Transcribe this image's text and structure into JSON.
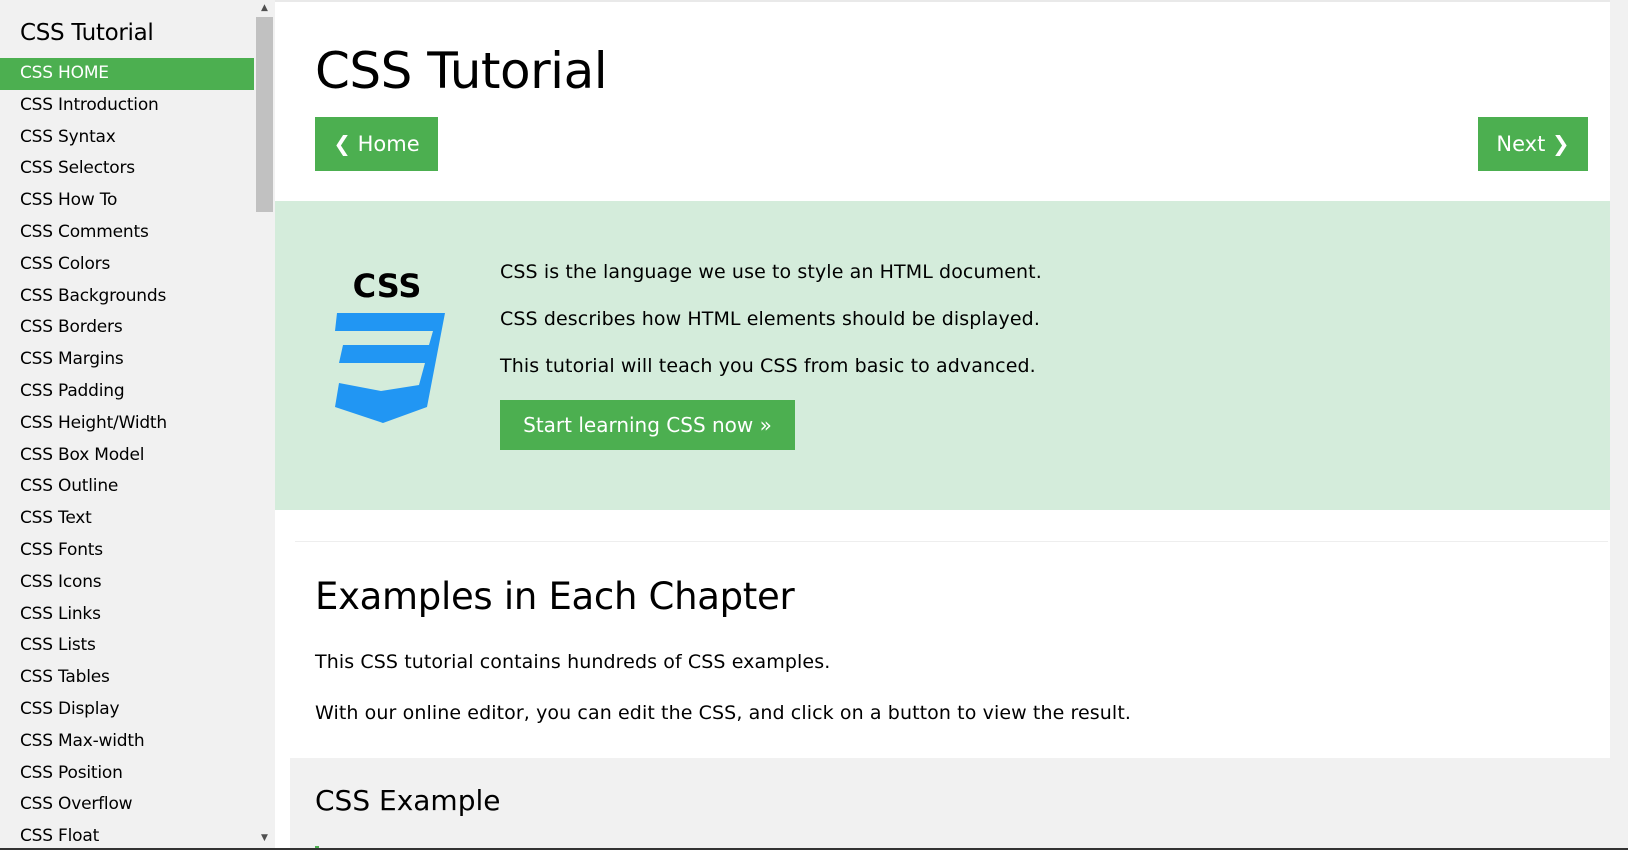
{
  "sidebar": {
    "title": "CSS Tutorial",
    "items": [
      {
        "label": "CSS HOME",
        "active": true
      },
      {
        "label": "CSS Introduction"
      },
      {
        "label": "CSS Syntax"
      },
      {
        "label": "CSS Selectors"
      },
      {
        "label": "CSS How To"
      },
      {
        "label": "CSS Comments"
      },
      {
        "label": "CSS Colors"
      },
      {
        "label": "CSS Backgrounds"
      },
      {
        "label": "CSS Borders"
      },
      {
        "label": "CSS Margins"
      },
      {
        "label": "CSS Padding"
      },
      {
        "label": "CSS Height/Width"
      },
      {
        "label": "CSS Box Model"
      },
      {
        "label": "CSS Outline"
      },
      {
        "label": "CSS Text"
      },
      {
        "label": "CSS Fonts"
      },
      {
        "label": "CSS Icons"
      },
      {
        "label": "CSS Links"
      },
      {
        "label": "CSS Lists"
      },
      {
        "label": "CSS Tables"
      },
      {
        "label": "CSS Display"
      },
      {
        "label": "CSS Max-width"
      },
      {
        "label": "CSS Position"
      },
      {
        "label": "CSS Overflow"
      },
      {
        "label": "CSS Float"
      }
    ]
  },
  "main": {
    "title": "CSS Tutorial",
    "home_button": "❮ Home",
    "next_button": "Next ❯",
    "hero": {
      "logo_text": "CSS",
      "line1": "CSS is the language we use to style an HTML document.",
      "line2": "CSS describes how HTML elements should be displayed.",
      "line3": "This tutorial will teach you CSS from basic to advanced.",
      "start_button": "Start learning CSS now »"
    },
    "examples": {
      "heading": "Examples in Each Chapter",
      "para1": "This CSS tutorial contains hundreds of CSS examples.",
      "para2": "With our online editor, you can edit the CSS, and click on a button to view the result.",
      "box_title": "CSS Example"
    }
  },
  "colors": {
    "accent": "#4caf50",
    "hero_bg": "#d4ecdb",
    "sidebar_bg": "#f1f1f1",
    "css_logo_blue": "#2196f3"
  },
  "icons": {
    "scroll_up": "triangle-up-icon",
    "scroll_down": "triangle-down-icon",
    "logo": "css3-shield-logo"
  }
}
